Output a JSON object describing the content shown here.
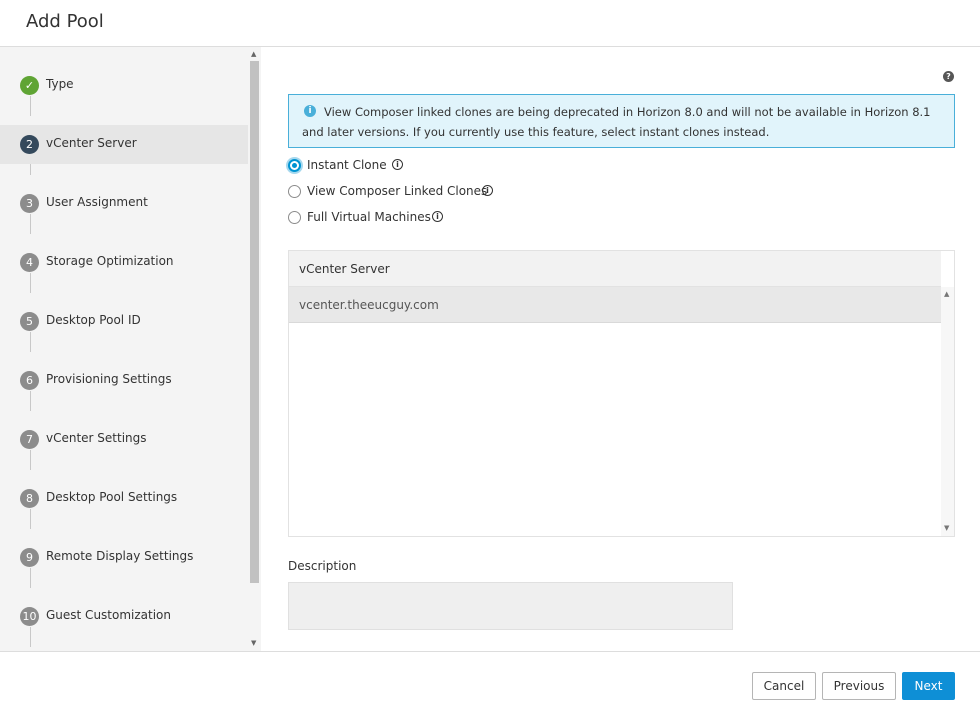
{
  "header": {
    "title": "Add Pool"
  },
  "sidebar": {
    "steps": [
      {
        "num": "✓",
        "label": "Type"
      },
      {
        "num": "2",
        "label": "vCenter Server"
      },
      {
        "num": "3",
        "label": "User Assignment"
      },
      {
        "num": "4",
        "label": "Storage Optimization"
      },
      {
        "num": "5",
        "label": "Desktop Pool ID"
      },
      {
        "num": "6",
        "label": "Provisioning Settings"
      },
      {
        "num": "7",
        "label": "vCenter Settings"
      },
      {
        "num": "8",
        "label": "Desktop Pool Settings"
      },
      {
        "num": "9",
        "label": "Remote Display Settings"
      },
      {
        "num": "10",
        "label": "Guest Customization"
      }
    ]
  },
  "banner": {
    "icon": "i",
    "text": "View Composer linked clones are being deprecated in Horizon 8.0 and will not be available in Horizon 8.1 and later versions. If you currently use this feature, select instant clones instead."
  },
  "help_icon": "?",
  "clone_options": [
    {
      "label": "Instant Clone",
      "checked": true
    },
    {
      "label": "View Composer Linked Clones",
      "checked": false
    },
    {
      "label": "Full Virtual Machines",
      "checked": false
    }
  ],
  "info_glyph": "i",
  "grid": {
    "header": "vCenter Server",
    "rows": [
      "vcenter.theeucguy.com"
    ]
  },
  "description": {
    "label": "Description",
    "value": ""
  },
  "footer": {
    "cancel": "Cancel",
    "previous": "Previous",
    "next": "Next"
  },
  "colors": {
    "primary": "#0e8fd6",
    "done": "#5fa434",
    "active_step": "#34495c",
    "banner_bg": "#e1f4fb"
  }
}
